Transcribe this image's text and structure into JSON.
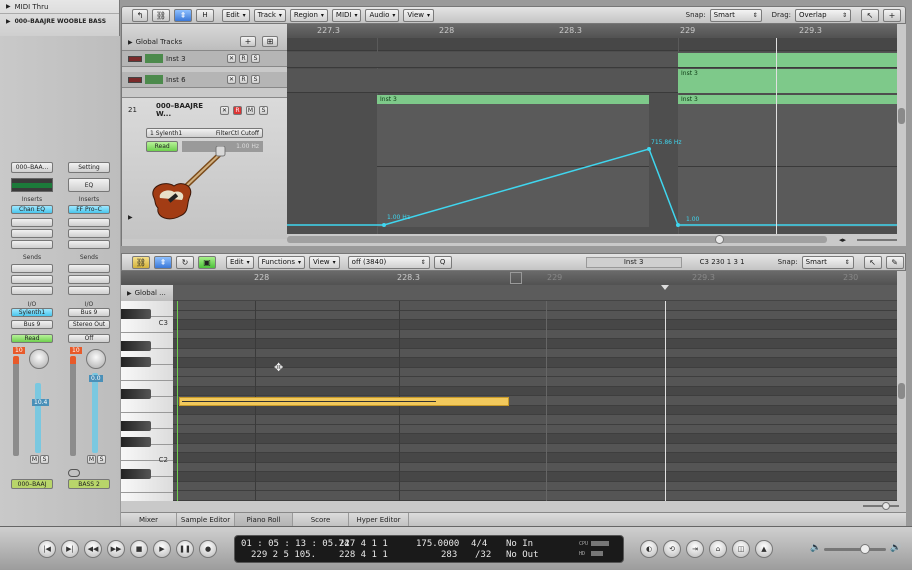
{
  "left_list": {
    "items": [
      "MIDI Thru",
      "000–BAAJRE WOOBLE BASS"
    ]
  },
  "arrange_toolbar": {
    "menus": [
      "Edit",
      "Track",
      "Region",
      "MIDI",
      "Audio",
      "View"
    ],
    "snap_label": "Snap:",
    "snap_value": "Smart",
    "drag_label": "Drag:",
    "drag_value": "Overlap"
  },
  "global_tracks": {
    "label": "Global Tracks"
  },
  "arrange_ruler": {
    "marks": [
      "227.3",
      "228",
      "228.3",
      "229",
      "229.3"
    ]
  },
  "tracks": [
    {
      "name": "Inst 3"
    },
    {
      "name": "Inst 6"
    },
    {
      "number": "21",
      "name": "000–BAAJRE W..."
    }
  ],
  "automation": {
    "plugin": "1 Sylenth1",
    "param": "FilterCtl Cutoff",
    "mode": "Read",
    "value": "1.00 Hz"
  },
  "regions": {
    "name": "Inst 3",
    "point_labels": [
      "1.00 Hz",
      "715.86 Hz",
      "1.00"
    ]
  },
  "channel_strip_1": {
    "name_box": "000–BAA...",
    "inserts_label": "Inserts",
    "insert": "Chan EQ",
    "sends_label": "Sends",
    "io_label": "I/O",
    "input": "Sylenth1",
    "output": "Bus 9",
    "automation": "Read",
    "fader_value": "10",
    "readout": "10.4",
    "mute": "M",
    "solo": "S",
    "track_name": "000–BAAJ"
  },
  "channel_strip_2": {
    "setting": "Setting",
    "eq": "EQ",
    "inserts_label": "Inserts",
    "insert": "FF Pro–C",
    "sends_label": "Sends",
    "io_label": "I/O",
    "input": "Bus 9",
    "output": "Stereo Out",
    "automation": "Off",
    "fader_value": "10",
    "readout": "0.0",
    "mute": "M",
    "solo": "S",
    "track_name": "BASS 2"
  },
  "piano_roll_toolbar": {
    "menus": [
      "Edit",
      "Functions",
      "View"
    ],
    "quantize": "off (3840)",
    "region_name": "Inst 3",
    "note_pos": "C3   230 1 3 1",
    "snap_label": "Snap:",
    "snap_value": "Smart"
  },
  "piano_roll": {
    "global_label": "Global ...",
    "ruler_marks": [
      "228",
      "228.3",
      "229",
      "229.3",
      "230"
    ],
    "key_labels": [
      "C3",
      "C2"
    ]
  },
  "bottom_tabs": [
    "Mixer",
    "Sample Editor",
    "Piano Roll",
    "Score",
    "Hyper Editor"
  ],
  "lcd": {
    "smpte": "01 : 05 : 13 : 05.74",
    "bars": "229    2    5   105.",
    "left_loc": "227    4    1     1",
    "right_loc": "228    4    1     1",
    "tempo": "175.0000",
    "sub": "283",
    "sig": "4/4",
    "div": "/32",
    "in": "No In",
    "out": "No Out",
    "cpu": "CPU",
    "hd": "HD"
  },
  "colors": {
    "accent_blue": "#3a78d8",
    "region_green": "#7ec98a",
    "automation_line": "#3fd6ef",
    "note_yellow": "#f2c95c"
  }
}
